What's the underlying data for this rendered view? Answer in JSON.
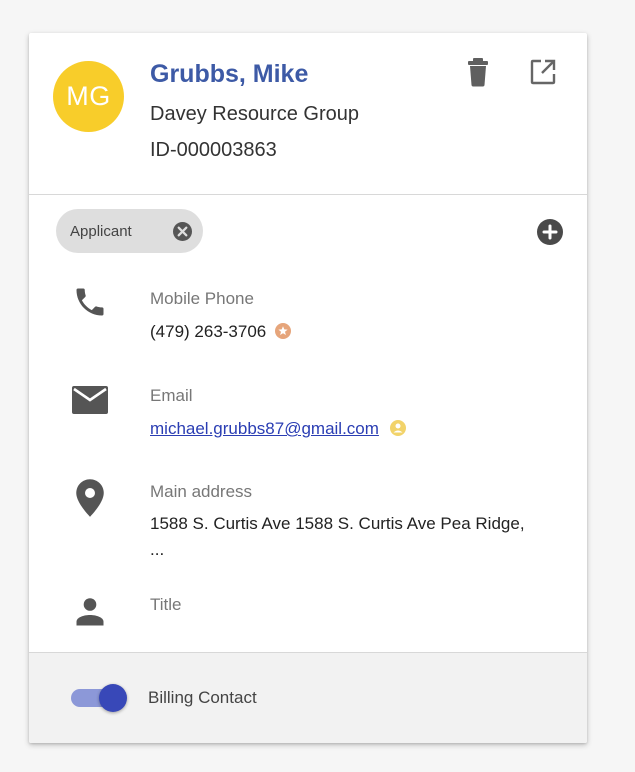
{
  "contact": {
    "initials": "MG",
    "name": "Grubbs, Mike",
    "company": "Davey Resource Group",
    "id": "ID-000003863"
  },
  "colors": {
    "avatar": "#f8cd2a",
    "name": "#3d5aa6",
    "link": "#2a3db3",
    "star": "#e6a57b",
    "person_badge": "#f2d36a",
    "toggle_track": "#8c98d8",
    "toggle_knob": "#3848b8"
  },
  "tags": [
    {
      "label": "Applicant"
    }
  ],
  "fields": {
    "phone": {
      "label": "Mobile Phone",
      "value": "(479) 263-3706",
      "icon": "phone-icon"
    },
    "email": {
      "label": "Email",
      "value": "michael.grubbs87@gmail.com",
      "icon": "mail-icon"
    },
    "address": {
      "label": "Main address",
      "value": "1588 S. Curtis Ave 1588 S. Curtis Ave Pea Ridge, ...",
      "icon": "location-pin-icon"
    },
    "title": {
      "label": "Title",
      "value": "",
      "icon": "person-icon"
    }
  },
  "footer": {
    "billing_label": "Billing Contact",
    "billing_enabled": true
  },
  "icons": {
    "delete": "trash-icon",
    "open": "open-in-new-icon",
    "add_tag": "add-circle-icon",
    "remove_tag": "close-circle-icon"
  }
}
